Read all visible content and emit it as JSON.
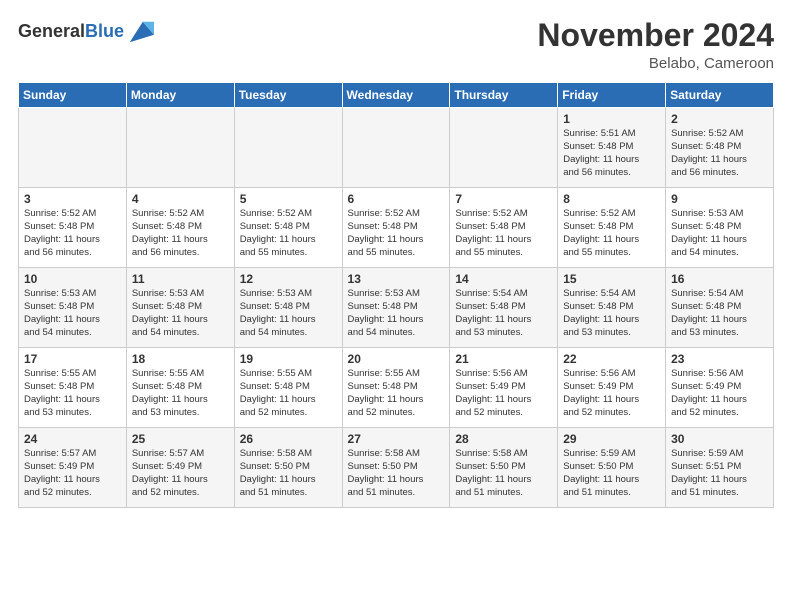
{
  "header": {
    "logo_general": "General",
    "logo_blue": "Blue",
    "month_title": "November 2024",
    "location": "Belabo, Cameroon"
  },
  "weekdays": [
    "Sunday",
    "Monday",
    "Tuesday",
    "Wednesday",
    "Thursday",
    "Friday",
    "Saturday"
  ],
  "weeks": [
    [
      {
        "day": "",
        "info": ""
      },
      {
        "day": "",
        "info": ""
      },
      {
        "day": "",
        "info": ""
      },
      {
        "day": "",
        "info": ""
      },
      {
        "day": "",
        "info": ""
      },
      {
        "day": "1",
        "info": "Sunrise: 5:51 AM\nSunset: 5:48 PM\nDaylight: 11 hours\nand 56 minutes."
      },
      {
        "day": "2",
        "info": "Sunrise: 5:52 AM\nSunset: 5:48 PM\nDaylight: 11 hours\nand 56 minutes."
      }
    ],
    [
      {
        "day": "3",
        "info": "Sunrise: 5:52 AM\nSunset: 5:48 PM\nDaylight: 11 hours\nand 56 minutes."
      },
      {
        "day": "4",
        "info": "Sunrise: 5:52 AM\nSunset: 5:48 PM\nDaylight: 11 hours\nand 56 minutes."
      },
      {
        "day": "5",
        "info": "Sunrise: 5:52 AM\nSunset: 5:48 PM\nDaylight: 11 hours\nand 55 minutes."
      },
      {
        "day": "6",
        "info": "Sunrise: 5:52 AM\nSunset: 5:48 PM\nDaylight: 11 hours\nand 55 minutes."
      },
      {
        "day": "7",
        "info": "Sunrise: 5:52 AM\nSunset: 5:48 PM\nDaylight: 11 hours\nand 55 minutes."
      },
      {
        "day": "8",
        "info": "Sunrise: 5:52 AM\nSunset: 5:48 PM\nDaylight: 11 hours\nand 55 minutes."
      },
      {
        "day": "9",
        "info": "Sunrise: 5:53 AM\nSunset: 5:48 PM\nDaylight: 11 hours\nand 54 minutes."
      }
    ],
    [
      {
        "day": "10",
        "info": "Sunrise: 5:53 AM\nSunset: 5:48 PM\nDaylight: 11 hours\nand 54 minutes."
      },
      {
        "day": "11",
        "info": "Sunrise: 5:53 AM\nSunset: 5:48 PM\nDaylight: 11 hours\nand 54 minutes."
      },
      {
        "day": "12",
        "info": "Sunrise: 5:53 AM\nSunset: 5:48 PM\nDaylight: 11 hours\nand 54 minutes."
      },
      {
        "day": "13",
        "info": "Sunrise: 5:53 AM\nSunset: 5:48 PM\nDaylight: 11 hours\nand 54 minutes."
      },
      {
        "day": "14",
        "info": "Sunrise: 5:54 AM\nSunset: 5:48 PM\nDaylight: 11 hours\nand 53 minutes."
      },
      {
        "day": "15",
        "info": "Sunrise: 5:54 AM\nSunset: 5:48 PM\nDaylight: 11 hours\nand 53 minutes."
      },
      {
        "day": "16",
        "info": "Sunrise: 5:54 AM\nSunset: 5:48 PM\nDaylight: 11 hours\nand 53 minutes."
      }
    ],
    [
      {
        "day": "17",
        "info": "Sunrise: 5:55 AM\nSunset: 5:48 PM\nDaylight: 11 hours\nand 53 minutes."
      },
      {
        "day": "18",
        "info": "Sunrise: 5:55 AM\nSunset: 5:48 PM\nDaylight: 11 hours\nand 53 minutes."
      },
      {
        "day": "19",
        "info": "Sunrise: 5:55 AM\nSunset: 5:48 PM\nDaylight: 11 hours\nand 52 minutes."
      },
      {
        "day": "20",
        "info": "Sunrise: 5:55 AM\nSunset: 5:48 PM\nDaylight: 11 hours\nand 52 minutes."
      },
      {
        "day": "21",
        "info": "Sunrise: 5:56 AM\nSunset: 5:49 PM\nDaylight: 11 hours\nand 52 minutes."
      },
      {
        "day": "22",
        "info": "Sunrise: 5:56 AM\nSunset: 5:49 PM\nDaylight: 11 hours\nand 52 minutes."
      },
      {
        "day": "23",
        "info": "Sunrise: 5:56 AM\nSunset: 5:49 PM\nDaylight: 11 hours\nand 52 minutes."
      }
    ],
    [
      {
        "day": "24",
        "info": "Sunrise: 5:57 AM\nSunset: 5:49 PM\nDaylight: 11 hours\nand 52 minutes."
      },
      {
        "day": "25",
        "info": "Sunrise: 5:57 AM\nSunset: 5:49 PM\nDaylight: 11 hours\nand 52 minutes."
      },
      {
        "day": "26",
        "info": "Sunrise: 5:58 AM\nSunset: 5:50 PM\nDaylight: 11 hours\nand 51 minutes."
      },
      {
        "day": "27",
        "info": "Sunrise: 5:58 AM\nSunset: 5:50 PM\nDaylight: 11 hours\nand 51 minutes."
      },
      {
        "day": "28",
        "info": "Sunrise: 5:58 AM\nSunset: 5:50 PM\nDaylight: 11 hours\nand 51 minutes."
      },
      {
        "day": "29",
        "info": "Sunrise: 5:59 AM\nSunset: 5:50 PM\nDaylight: 11 hours\nand 51 minutes."
      },
      {
        "day": "30",
        "info": "Sunrise: 5:59 AM\nSunset: 5:51 PM\nDaylight: 11 hours\nand 51 minutes."
      }
    ]
  ]
}
